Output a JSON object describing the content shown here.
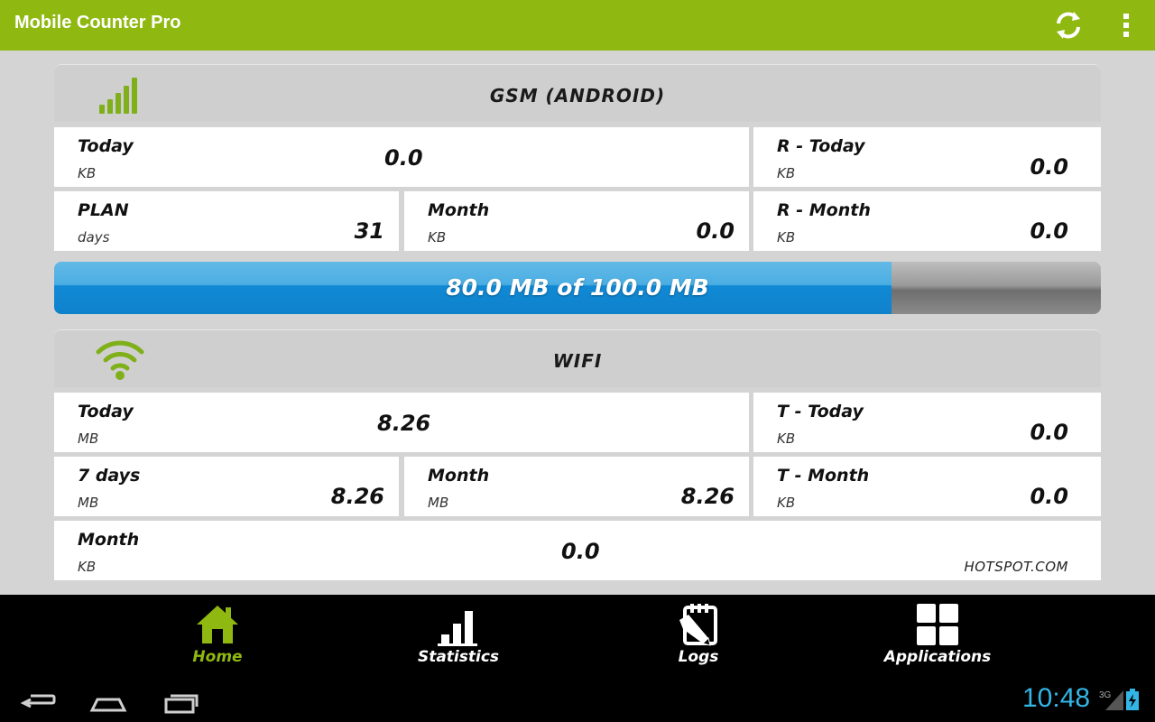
{
  "app": {
    "title": "Mobile Counter Pro"
  },
  "colors": {
    "accent": "#8fb810",
    "progress_fill": "#1189d4",
    "clock": "#33b5e5"
  },
  "gsm": {
    "title": "GSM (ANDROID)",
    "icon": "signal-bars-icon",
    "today": {
      "label": "Today",
      "unit": "KB",
      "value": "0.0"
    },
    "r_today": {
      "label": "R - Today",
      "unit": "KB",
      "value": "0.0"
    },
    "plan": {
      "label": "PLAN",
      "unit": "days",
      "value": "31"
    },
    "month": {
      "label": "Month",
      "unit": "KB",
      "value": "0.0"
    },
    "r_month": {
      "label": "R - Month",
      "unit": "KB",
      "value": "0.0"
    }
  },
  "usage": {
    "text": "80.0 MB of 100.0 MB",
    "used_mb": 80.0,
    "total_mb": 100.0
  },
  "wifi": {
    "title": "WIFI",
    "icon": "wifi-icon",
    "today": {
      "label": "Today",
      "unit": "MB",
      "value": "8.26"
    },
    "t_today": {
      "label": "T - Today",
      "unit": "KB",
      "value": "0.0"
    },
    "seven_days": {
      "label": "7 days",
      "unit": "MB",
      "value": "8.26"
    },
    "month": {
      "label": "Month",
      "unit": "MB",
      "value": "8.26"
    },
    "t_month": {
      "label": "T - Month",
      "unit": "KB",
      "value": "0.0"
    },
    "hotspot": {
      "label": "Month",
      "unit": "KB",
      "value": "0.0",
      "name": "HOTSPOT.COM"
    }
  },
  "nav": {
    "home": {
      "label": "Home",
      "icon": "home-icon"
    },
    "statistics": {
      "label": "Statistics",
      "icon": "bar-chart-icon"
    },
    "logs": {
      "label": "Logs",
      "icon": "logs-icon"
    },
    "applications": {
      "label": "Applications",
      "icon": "grid-icon"
    }
  },
  "status": {
    "time": "10:48",
    "network": "3G"
  }
}
